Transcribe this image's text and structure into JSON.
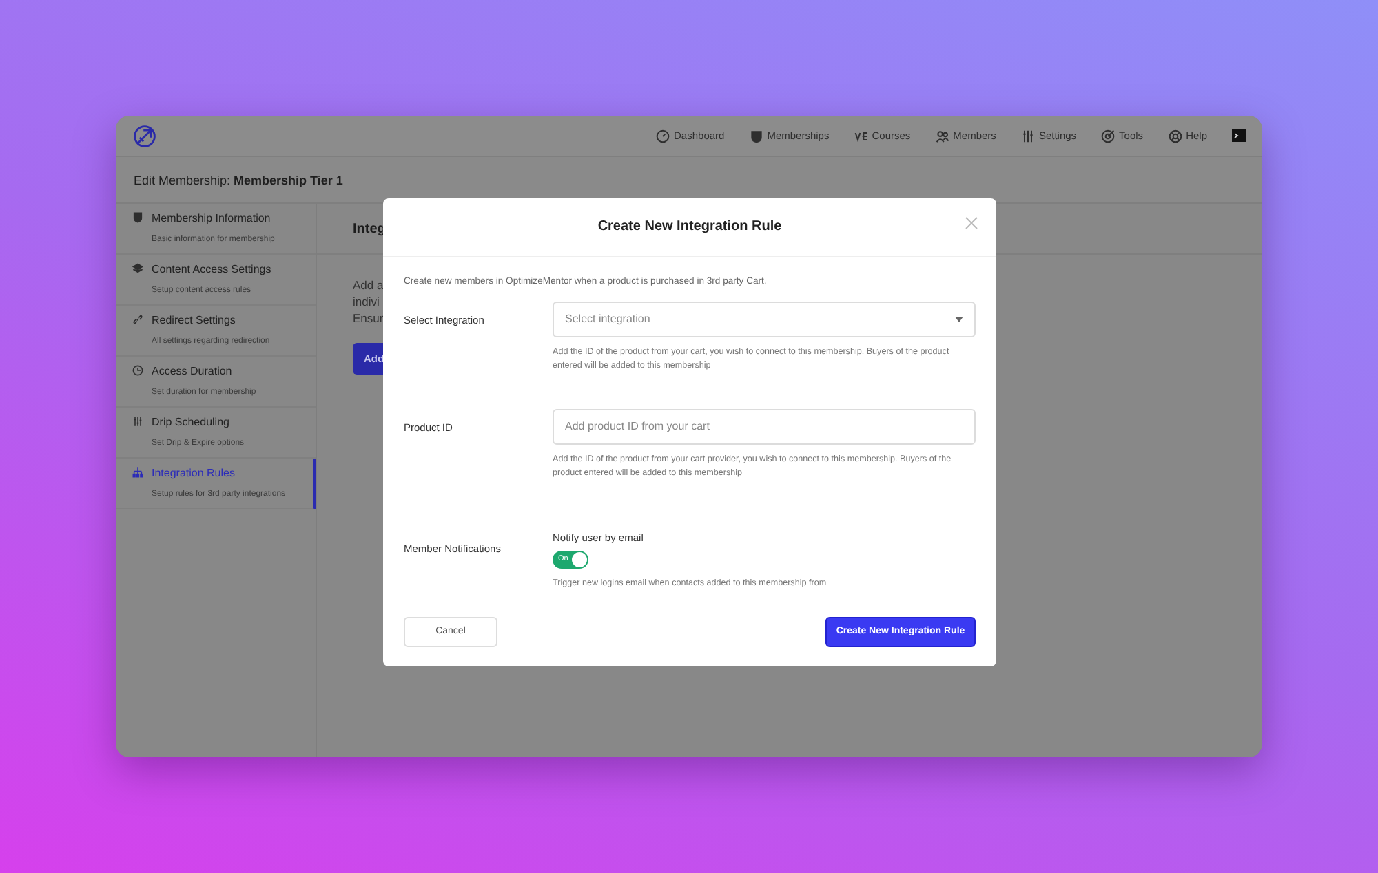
{
  "app": {
    "nav": [
      {
        "label": "Dashboard"
      },
      {
        "label": "Memberships"
      },
      {
        "label": "Courses"
      },
      {
        "label": "Members"
      },
      {
        "label": "Settings"
      },
      {
        "label": "Tools"
      },
      {
        "label": "Help"
      }
    ],
    "page_title": {
      "prefix": "Edit Membership:",
      "name": "Membership Tier 1"
    },
    "sidebar": {
      "items": [
        {
          "title": "Membership Information",
          "subtitle": "Basic information for membership",
          "selected": false
        },
        {
          "title": "Content Access Settings",
          "subtitle": "Setup content access rules",
          "selected": false
        },
        {
          "title": "Redirect Settings",
          "subtitle": "All settings regarding redirection",
          "selected": false
        },
        {
          "title": "Access Duration",
          "subtitle": "Set duration for membership",
          "selected": false
        },
        {
          "title": "Drip Scheduling",
          "subtitle": "Set Drip & Expire options",
          "selected": false
        },
        {
          "title": "Integration Rules",
          "subtitle": "Setup rules for 3rd party integrations",
          "selected": true
        }
      ]
    },
    "main": {
      "heading": "Integ",
      "lines": [
        "Add a",
        "indivi",
        "Ensur"
      ],
      "button": "Add"
    }
  },
  "modal": {
    "title": "Create New Integration Rule",
    "intro": "Create new members in OptimizeMentor when a product is purchased in 3rd party Cart.",
    "fields": [
      {
        "kind": "select",
        "label": "Select Integration",
        "placeholder": "Select integration",
        "help": "Add the ID of the product from your cart, you wish to connect to this membership. Buyers of the product entered will be added to this membership"
      },
      {
        "kind": "text",
        "label": "Product ID",
        "placeholder": "Add product ID from your cart",
        "help": "Add the ID of the product from your cart provider, you wish to connect to this membership. Buyers of the product entered will be added to this membership"
      },
      {
        "kind": "toggle",
        "label": "Member Notifications",
        "caption": "Notify user by email",
        "on": true,
        "toggle_text": "On",
        "help": "Trigger new logins email when contacts added to this membership from"
      }
    ],
    "cancel": "Cancel",
    "submit": "Create New Integration Rule"
  }
}
